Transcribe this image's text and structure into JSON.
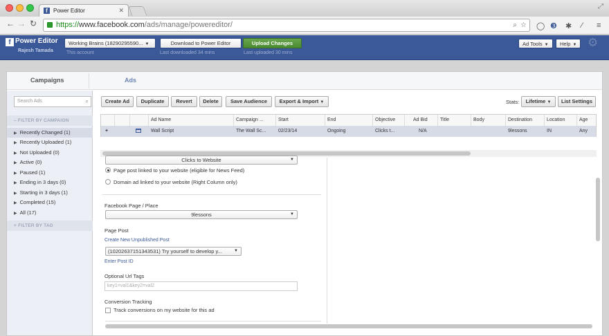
{
  "browser": {
    "tab_title": "Power Editor",
    "url_scheme": "https://",
    "url_host": "www.facebook.com",
    "url_path": "/ads/manage/powereditor/"
  },
  "header": {
    "logo_text": "Power Editor",
    "user_name": "Rajesh Tamada",
    "account_label": "Working Brains (18290295590...",
    "account_sub": "This account",
    "download_label": "Download to Power Editor",
    "download_sub": "Last downloaded 34 mins",
    "upload_label": "Upload Changes",
    "upload_sub": "Last uploaded 30 mins",
    "ad_tools_label": "Ad Tools",
    "help_label": "Help"
  },
  "tabs": [
    {
      "label": "Campaigns"
    },
    {
      "label": "Ads"
    }
  ],
  "sidebar": {
    "search_placeholder": "Search Ads",
    "filter_campaign_header": "FILTER BY CAMPAIGN",
    "items": [
      {
        "label": "Recently Changed (1)"
      },
      {
        "label": "Recently Uploaded (1)"
      },
      {
        "label": "Not Uploaded (0)"
      },
      {
        "label": "Active (0)"
      },
      {
        "label": "Paused (1)"
      },
      {
        "label": "Ending in 3 days (0)"
      },
      {
        "label": "Starting in 3 days (1)"
      },
      {
        "label": "Completed (15)"
      },
      {
        "label": "All (17)"
      }
    ],
    "filter_tag_header": "FILTER BY TAG"
  },
  "actions": {
    "create_ad": "Create Ad",
    "duplicate": "Duplicate",
    "revert": "Revert",
    "delete": "Delete",
    "save_audience": "Save Audience",
    "export_import": "Export & Import",
    "stats_label": "Stats:",
    "lifetime": "Lifetime",
    "list_settings": "List Settings"
  },
  "table": {
    "columns": [
      "Ad Name",
      "Campaign ...",
      "Start",
      "End",
      "Objective",
      "Ad Bid",
      "Title",
      "Body",
      "Destination",
      "Location",
      "Age"
    ],
    "row": {
      "add": "+",
      "ad_name": "Wall Script",
      "campaign": "The Wall Sc...",
      "start": "02/23/14",
      "end": "Ongoing",
      "objective": "Clicks t...",
      "ad_bid": "N/A",
      "title": "",
      "body": "",
      "destination": "9lessons",
      "location": "IN",
      "age": "Any"
    }
  },
  "form": {
    "objective_select": "Clicks to Website",
    "radio_page_post": "Page post linked to your website (eligible for News Feed)",
    "radio_domain_ad": "Domain ad linked to your website (Right Column only)",
    "page_label": "Facebook Page / Place",
    "page_select": "9lessons",
    "page_post_label": "Page Post",
    "create_post_link": "Create New Unpublished Post",
    "post_select": "(10202637151343531) Try yourself to develop y...",
    "enter_post_id": "Enter Post ID",
    "url_tags_label": "Optional Url Tags",
    "url_tags_placeholder": "key1=val1&key2=val2",
    "conversion_label": "Conversion Tracking",
    "conversion_checkbox": "Track conversions on my website for this ad"
  }
}
